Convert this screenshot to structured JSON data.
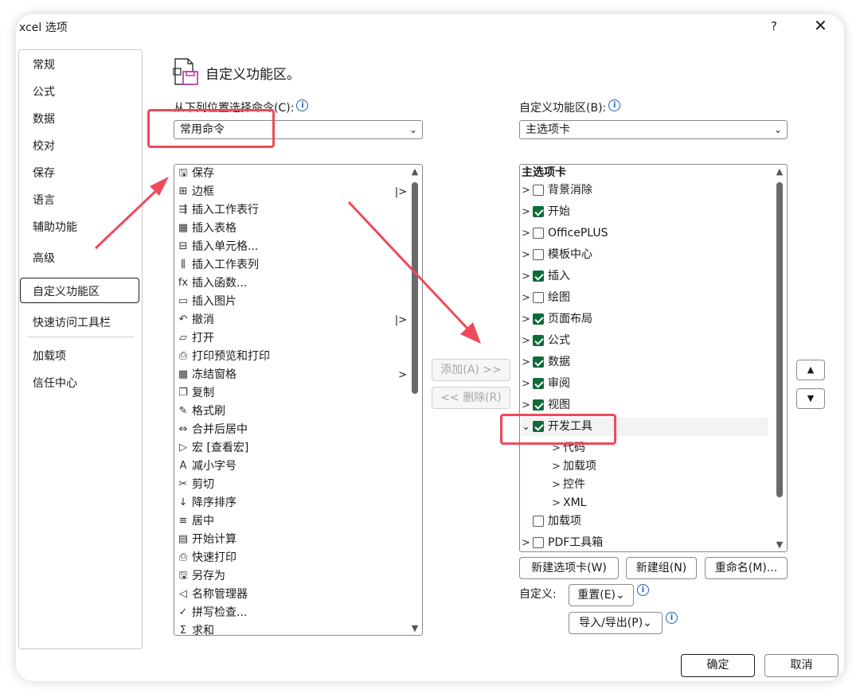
{
  "window": {
    "title": "xcel 选项",
    "help_label": "?",
    "close_label": "✕"
  },
  "nav": {
    "items": [
      "常规",
      "公式",
      "数据",
      "校对",
      "保存",
      "语言",
      "辅助功能",
      "高级",
      "自定义功能区",
      "快速访问工具栏",
      "加载项",
      "信任中心"
    ],
    "selected": "自定义功能区"
  },
  "header": {
    "title": "自定义功能区。"
  },
  "left": {
    "label": "从下列位置选择命令(C):",
    "combo_value": "常用命令",
    "commands": [
      {
        "label": "保存",
        "icon": "save-icon",
        "glyph": "🖫"
      },
      {
        "label": "边框",
        "icon": "border-icon",
        "glyph": "⊞",
        "submenu": "|>"
      },
      {
        "label": "插入工作表行",
        "icon": "insert-row-icon",
        "glyph": "⇶"
      },
      {
        "label": "插入表格",
        "icon": "insert-table-icon",
        "glyph": "▦"
      },
      {
        "label": "插入单元格...",
        "icon": "insert-cell-icon",
        "glyph": "⊟"
      },
      {
        "label": "插入工作表列",
        "icon": "insert-column-icon",
        "glyph": "⫼"
      },
      {
        "label": "插入函数...",
        "icon": "function-icon",
        "glyph": "fx"
      },
      {
        "label": "插入图片",
        "icon": "picture-icon",
        "glyph": "▭"
      },
      {
        "label": "撤消",
        "icon": "undo-icon",
        "glyph": "↶",
        "submenu": "|>"
      },
      {
        "label": "打开",
        "icon": "open-folder-icon",
        "glyph": "▱"
      },
      {
        "label": "打印预览和打印",
        "icon": "print-preview-icon",
        "glyph": "⎙"
      },
      {
        "label": "冻结窗格",
        "icon": "freeze-panes-icon",
        "glyph": "▦",
        "submenu": ">"
      },
      {
        "label": "复制",
        "icon": "copy-icon",
        "glyph": "❐"
      },
      {
        "label": "格式刷",
        "icon": "format-painter-icon",
        "glyph": "✎"
      },
      {
        "label": "合并后居中",
        "icon": "merge-center-icon",
        "glyph": "⇔"
      },
      {
        "label": "宏 [查看宏]",
        "icon": "macro-icon",
        "glyph": "▷"
      },
      {
        "label": "减小字号",
        "icon": "decrease-font-icon",
        "glyph": "A"
      },
      {
        "label": "剪切",
        "icon": "cut-icon",
        "glyph": "✂"
      },
      {
        "label": "降序排序",
        "icon": "sort-desc-icon",
        "glyph": "↓"
      },
      {
        "label": "居中",
        "icon": "center-align-icon",
        "glyph": "≡"
      },
      {
        "label": "开始计算",
        "icon": "calculator-icon",
        "glyph": "▤"
      },
      {
        "label": "快速打印",
        "icon": "quick-print-icon",
        "glyph": "⎙"
      },
      {
        "label": "另存为",
        "icon": "save-as-icon",
        "glyph": "🖫"
      },
      {
        "label": "名称管理器",
        "icon": "name-manager-icon",
        "glyph": "◁"
      },
      {
        "label": "拼写检查...",
        "icon": "spell-check-icon",
        "glyph": "✓"
      },
      {
        "label": "求和",
        "icon": "sum-icon",
        "glyph": "Σ"
      }
    ]
  },
  "middle": {
    "add_label": "添加(A) >>",
    "remove_label": "<< 删除(R)"
  },
  "right": {
    "label": "自定义功能区(B):",
    "combo_value": "主选项卡",
    "tree": [
      {
        "label": "主选项卡",
        "bold": true,
        "level": 0,
        "chevron": "",
        "check": null
      },
      {
        "label": "背景消除",
        "level": 0,
        "chevron": ">",
        "check": false
      },
      {
        "label": "开始",
        "level": 0,
        "chevron": ">",
        "check": true
      },
      {
        "label": "OfficePLUS",
        "level": 0,
        "chevron": ">",
        "check": false
      },
      {
        "label": "模板中心",
        "level": 0,
        "chevron": ">",
        "check": false
      },
      {
        "label": "插入",
        "level": 0,
        "chevron": ">",
        "check": true
      },
      {
        "label": "绘图",
        "level": 0,
        "chevron": ">",
        "check": false
      },
      {
        "label": "页面布局",
        "level": 0,
        "chevron": ">",
        "check": true
      },
      {
        "label": "公式",
        "level": 0,
        "chevron": ">",
        "check": true
      },
      {
        "label": "数据",
        "level": 0,
        "chevron": ">",
        "check": true
      },
      {
        "label": "审阅",
        "level": 0,
        "chevron": ">",
        "check": true
      },
      {
        "label": "视图",
        "level": 0,
        "chevron": ">",
        "check": true
      },
      {
        "label": "开发工具",
        "level": 0,
        "chevron": "⌄",
        "check": true,
        "expanded": true
      },
      {
        "label": "代码",
        "level": 1,
        "chevron": ">",
        "check": null
      },
      {
        "label": "加载项",
        "level": 1,
        "chevron": ">",
        "check": null
      },
      {
        "label": "控件",
        "level": 1,
        "chevron": ">",
        "check": null
      },
      {
        "label": "XML",
        "level": 1,
        "chevron": ">",
        "check": null
      },
      {
        "label": "加载项",
        "level": 0,
        "chevron": "",
        "check": false
      },
      {
        "label": "PDF工具箱",
        "level": 0,
        "chevron": ">",
        "check": false
      }
    ],
    "new_tab_label": "新建选项卡(W)",
    "new_group_label": "新建组(N)",
    "rename_label": "重命名(M)...",
    "customize_label": "自定义:",
    "reset_label": "重置(E)⌄",
    "import_export_label": "导入/导出(P)⌄"
  },
  "footer": {
    "ok_label": "确定",
    "cancel_label": "取消"
  },
  "annotations": {
    "highlight_color": "#ee4a5b"
  }
}
